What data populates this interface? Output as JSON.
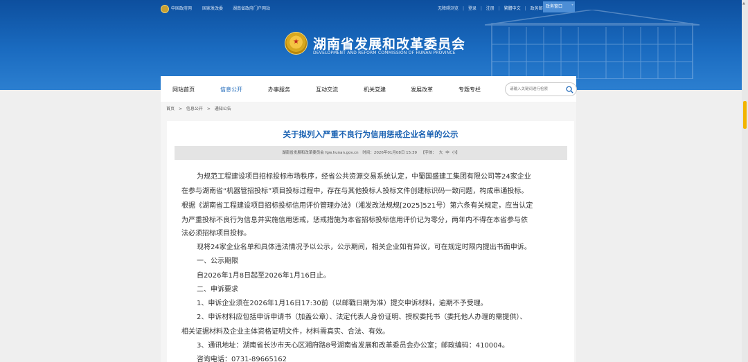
{
  "topbar": {
    "links": [
      "中国政府网",
      "国家发改委",
      "湖南省政府门户网站"
    ],
    "right": [
      "无障碍浏览",
      "登录",
      "注册",
      "繁體中文",
      "政务邮箱"
    ],
    "mobile": "政务窗口",
    "mobile_arrow": "˅"
  },
  "header": {
    "title": "湖南省发展和改革委员会",
    "subtitle": "DEVELOPMENT AND REFORM COMMISSION OF HUNAN PROVINCE"
  },
  "nav": {
    "items": [
      "网站首页",
      "信息公开",
      "办事服务",
      "互动交流",
      "机关党建",
      "发展改革",
      "专题专栏"
    ],
    "search_placeholder": "请输入关键词进行检索"
  },
  "breadcrumb": [
    "首页",
    ">",
    "信息公开",
    ">",
    "通知公告"
  ],
  "article": {
    "title": "关于拟列入严重不良行为信用惩戒企业名单的公示",
    "source": "湖南省发展和改革委员会 fgw.hunan.gov.cn",
    "time": "时间：2026年01月08日 15:39",
    "font_label": "【字体：",
    "font_large": "大",
    "font_medium": "中",
    "font_small": "小】",
    "lines": [
      "为规范工程建设项目招标投标市场秩序，经省公共资源交易系统认定，中蜀国盛建工集团有限公司等24家企业",
      "在参与湖南省“机器管招投标”项目投标过程中，存在与其他投标人投标文件创建标识码一致问题，构成串通投标。",
      "根据《湖南省工程建设项目招标投标信用评价管理办法》（湘发改法规规[2025]521号）第六条有关规定，应当认定",
      "为严重投标不良行为信息并实施信用惩戒，惩戒措施为本省招标投标信用评价记为零分，两年内不得在本省参与依",
      "法必须招标项目投标。",
      "现将24家企业名单和具体违法情况予以公示，公示期间，相关企业如有异议，可在规定时限内提出书面申诉。",
      "一、公示期限",
      "自2026年1月8日起至2026年1月16日止。",
      "二、申诉要求",
      "1、申诉企业须在2026年1月16日17:30前（以邮戳日期为准）提交申诉材料，逾期不予受理。",
      "2、申诉材料应包括申诉申请书（加盖公章）、法定代表人身份证明、授权委托书（委托他人办理的需提供）、",
      "相关证据材料及企业主体资格证明文件，材料需真实、合法、有效。",
      "3、通讯地址：湖南省长沙市天心区湘府路8号湖南省发展和改革委员会办公室；邮政编码：410004。",
      "咨询电话：0731-89665162"
    ]
  },
  "colors": {
    "banner": "#1a6bc0",
    "title": "#1c63b3",
    "nav_active": "#1a66b8",
    "scroll_thumb": "#f2b400"
  }
}
